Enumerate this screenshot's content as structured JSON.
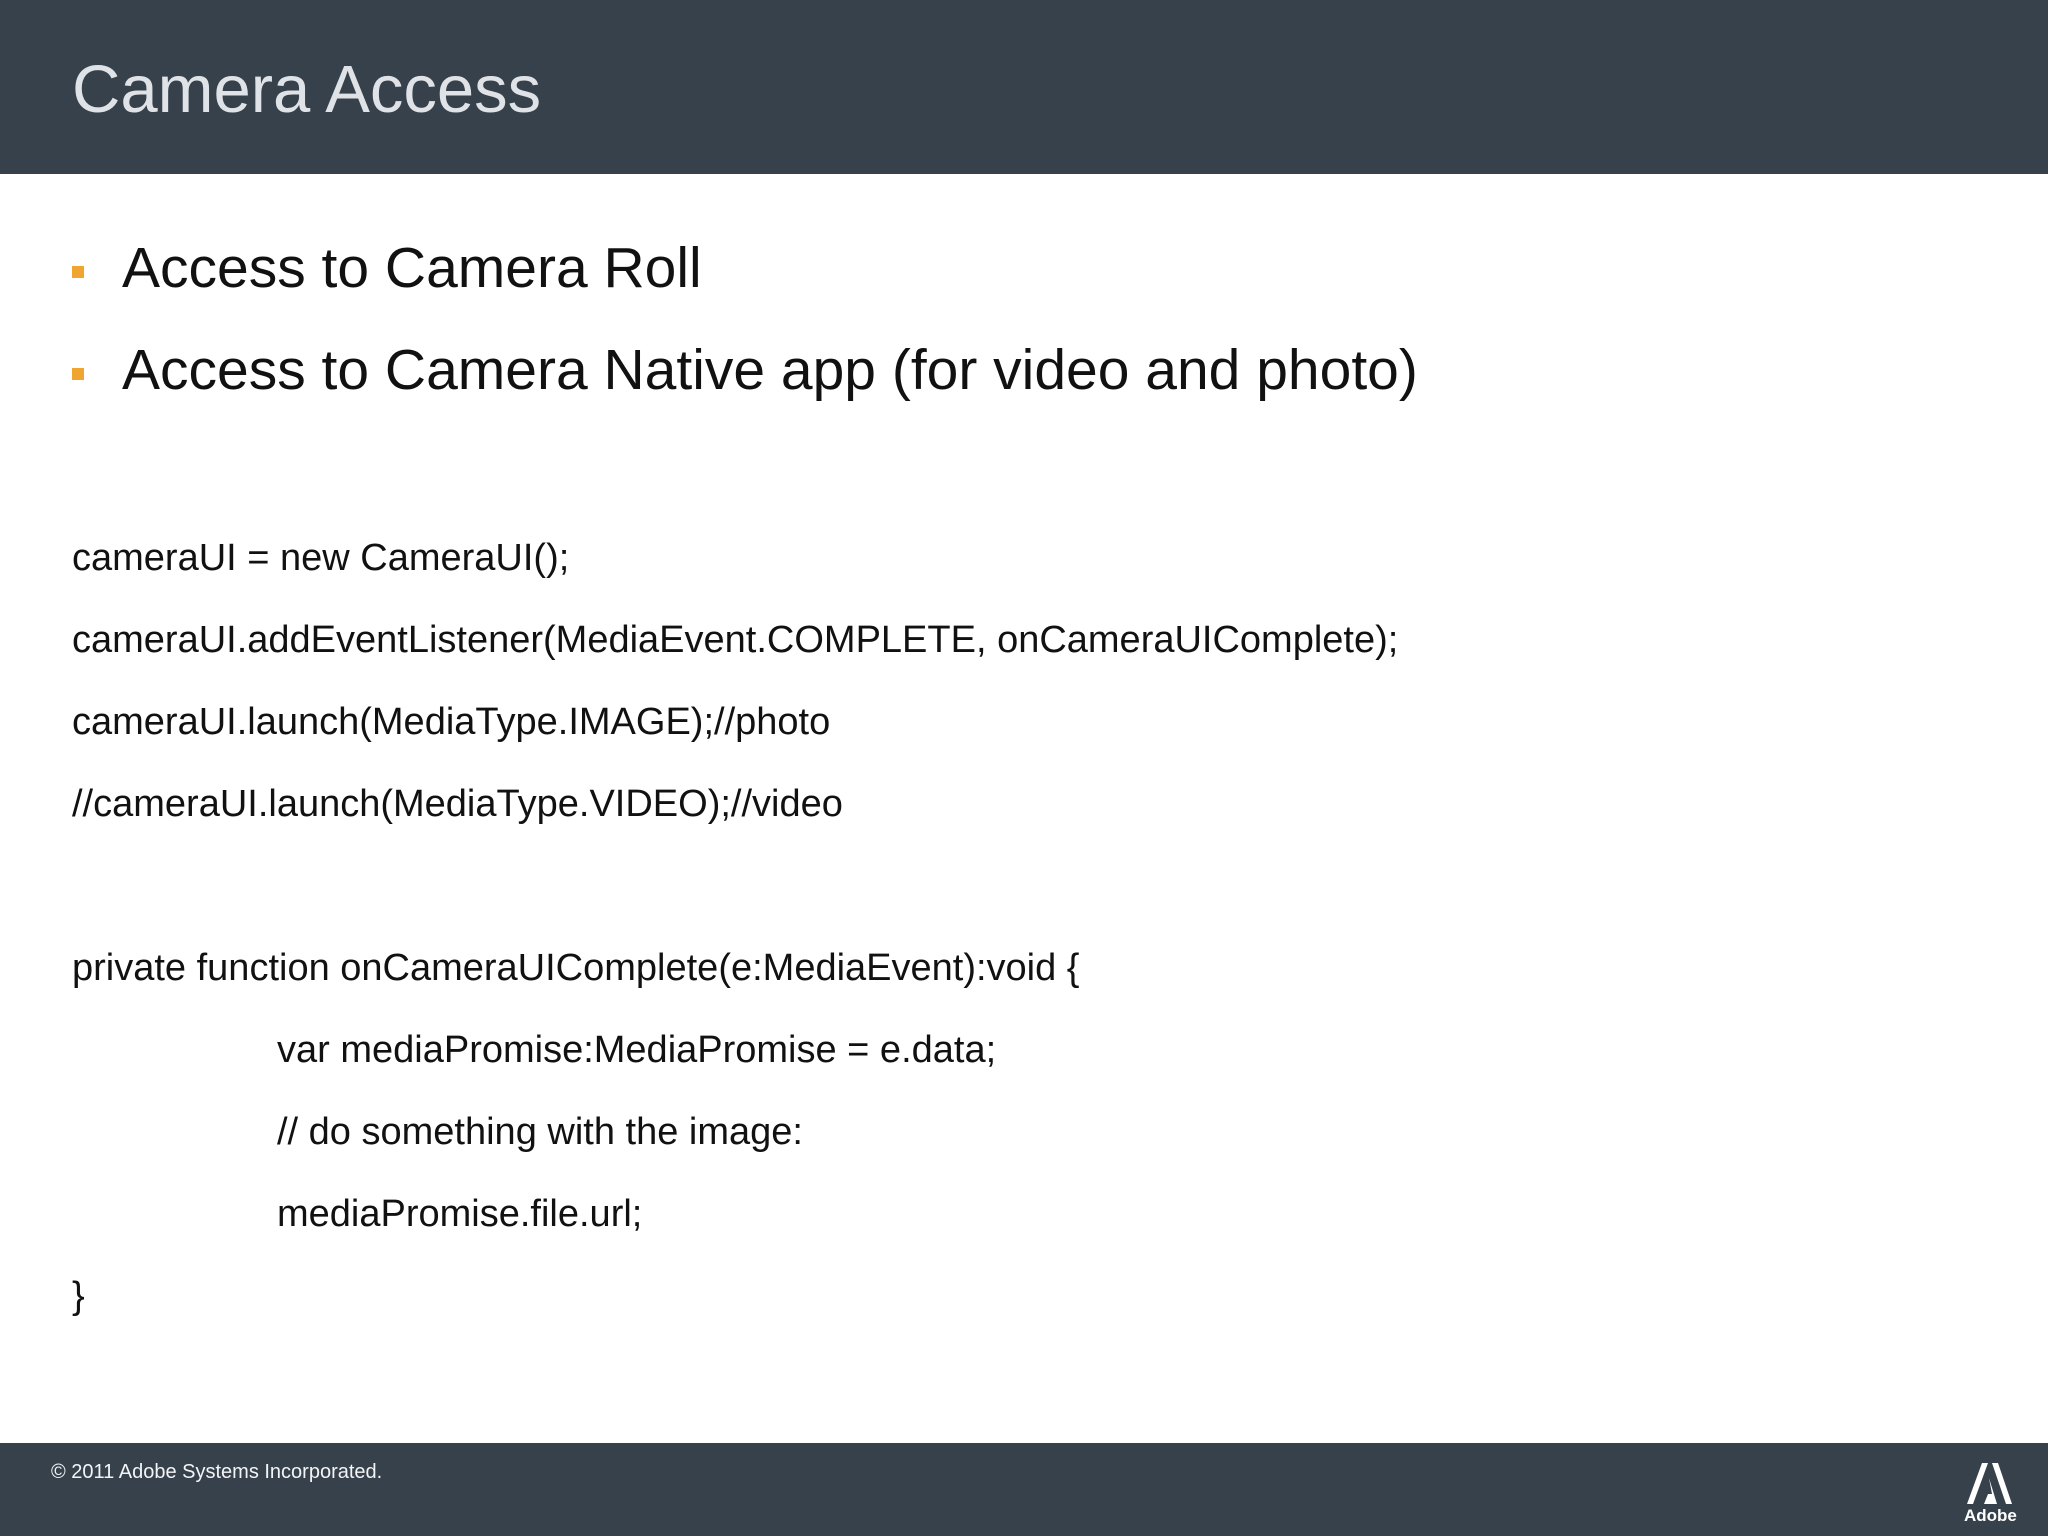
{
  "header": {
    "title": "Camera Access"
  },
  "bullets": [
    {
      "text": "Access to Camera Roll"
    },
    {
      "text": "Access to Camera Native app (for video and photo)"
    }
  ],
  "code_lines": [
    {
      "text": "cameraUI = new CameraUI();"
    },
    {
      "text": "cameraUI.addEventListener(MediaEvent.COMPLETE, onCameraUIComplete);"
    },
    {
      "text": "cameraUI.launch(MediaType.IMAGE);//photo"
    },
    {
      "text": "//cameraUI.launch(MediaType.VIDEO);//video"
    },
    {
      "text": "private function onCameraUIComplete(e:MediaEvent):void {"
    },
    {
      "text": "var mediaPromise:MediaPromise = e.data;"
    },
    {
      "text": "// do something with the image:"
    },
    {
      "text": "mediaPromise.file.url;"
    },
    {
      "text": "}"
    }
  ],
  "footer": {
    "copyright": "© 2011 Adobe Systems Incorporated.",
    "logo_text": "Adobe",
    "logo_icon": "adobe-logo-icon"
  },
  "colors": {
    "header_bg": "#37414b",
    "bullet_accent": "#f0a531",
    "title_text": "#dfe3e7"
  }
}
